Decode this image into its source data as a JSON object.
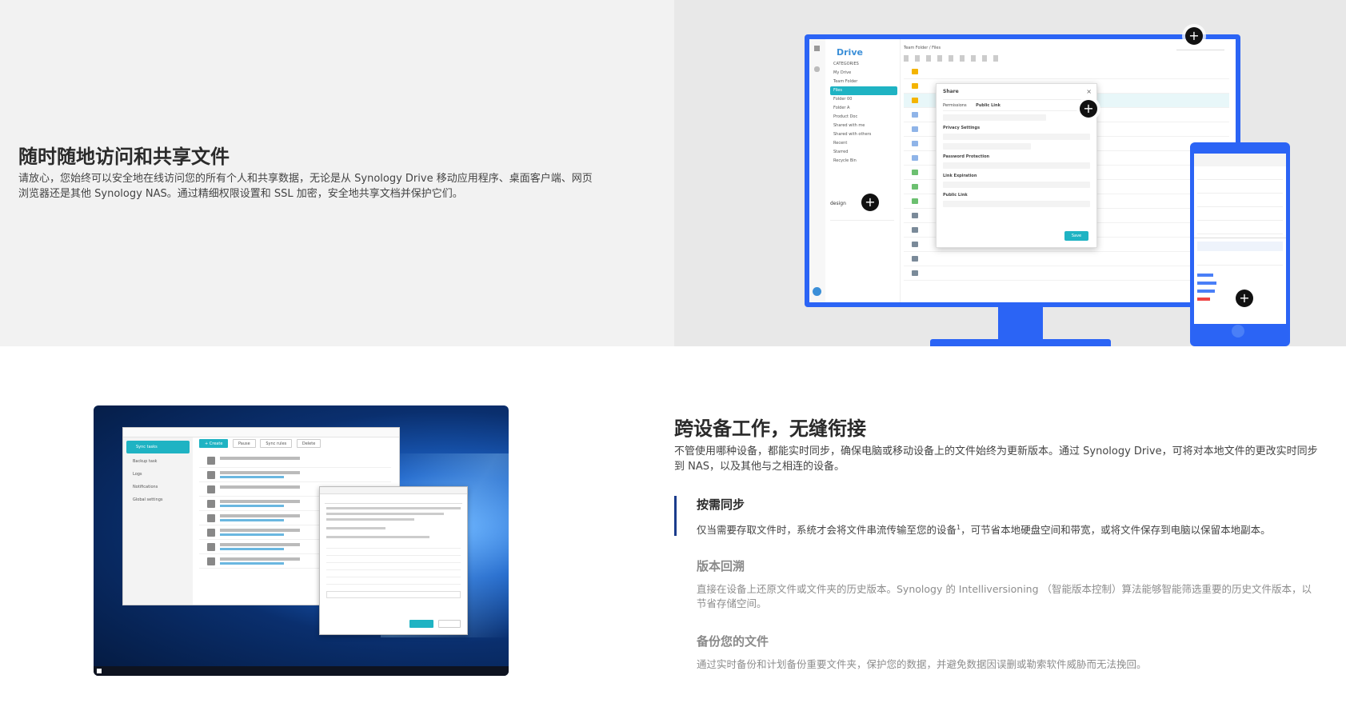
{
  "section1": {
    "title": "随时随地访问和共享文件",
    "description": "请放心，您始终可以安全地在线访问您的所有个人和共享数据，无论是从 Synology Drive 移动应用程序、桌面客户端、网页浏览器还是其他 Synology NAS。通过精细权限设置和 SSL 加密，安全地共享文档并保护它们。"
  },
  "drive_ui": {
    "logo": "Drive",
    "nav_items": [
      "CATEGORIES",
      "My Drive",
      "Team Folder",
      "Files",
      "Folder 00",
      "Folder A",
      "Product Doc",
      "Shared with me",
      "Shared with others",
      "Recent",
      "Starred",
      "Recycle Bin"
    ],
    "user": "design",
    "breadcrumb": "Team Folder / Files",
    "share_dialog": {
      "title": "Share",
      "tab_permissions": "Permissions",
      "tab_public_link": "Public Link",
      "privacy_settings": "Privacy Settings",
      "password_protection": "Password Protection",
      "link_expiration": "Link Expiration",
      "public_link": "Public Link",
      "save": "Save"
    }
  },
  "section2": {
    "title": "跨设备工作，无缝衔接",
    "description": "不管使用哪种设备，都能实时同步，确保电脑或移动设备上的文件始终为更新版本。通过 Synology Drive，可将对本地文件的更改实时同步到 NAS，以及其他与之相连的设备。"
  },
  "features": [
    {
      "title": "按需同步",
      "description": "仅当需要存取文件时，系统才会将文件串流传输至您的设备",
      "footnote": "1",
      "description_tail": "，可节省本地硬盘空间和带宽，或将文件保存到电脑以保留本地副本。"
    },
    {
      "title": "版本回溯",
      "description": "直接在设备上还原文件或文件夹的历史版本。Synology 的 Intelliversioning （智能版本控制）算法能够智能筛选重要的历史文件版本，以节省存储空间。"
    },
    {
      "title": "备份您的文件",
      "description": "通过实时备份和计划备份重要文件夹，保护您的数据，并避免数据因误删或勒索软件威胁而无法挽回。"
    }
  ],
  "sync_app": {
    "nav_items": [
      "Sync tasks",
      "Backup task",
      "Logs",
      "Notifications",
      "Global settings"
    ],
    "toolbar": [
      "+ Create",
      "Pause",
      "Sync rules",
      "Delete"
    ]
  },
  "icons": {
    "plus": "+"
  },
  "colors": {
    "accent_blue": "#2b64f5",
    "teal": "#1fb3c3",
    "active_border": "#1a3c8c"
  }
}
